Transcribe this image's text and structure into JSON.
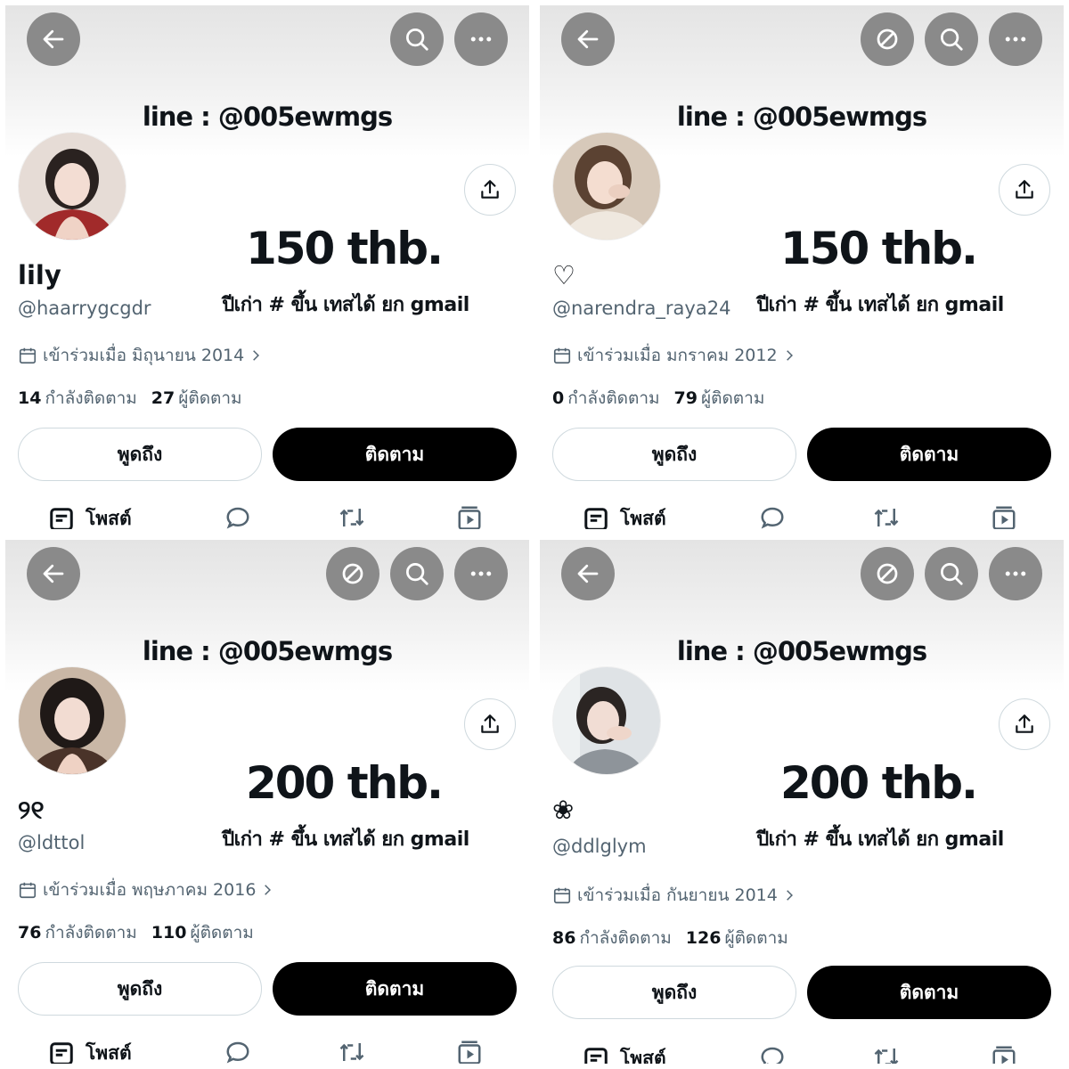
{
  "banner_text": "line : @005ewmgs",
  "shared": {
    "description": "ปีเก่า # ขึ้น เทสได้ ยก gmail",
    "joined_prefix": "เข้าร่วมเมื่อ",
    "following_label": "กำลังติดตาม",
    "followers_label": "ผู้ติดตาม",
    "mention_label": "พูดถึง",
    "follow_label": "ติดตาม",
    "posts_tab_label": "โพสต์"
  },
  "colors": {
    "control_bg": "#8a8a8a",
    "follow_bg": "#000000",
    "muted_text": "#536471",
    "text": "#0f1419"
  },
  "icons": [
    "back-arrow-icon",
    "block-icon",
    "search-icon",
    "more-icon",
    "share-icon",
    "calendar-icon",
    "chevron-right-icon",
    "posts-icon",
    "replies-icon",
    "reposts-icon",
    "media-icon"
  ],
  "profiles": [
    {
      "display_name": "lily",
      "handle": "@haarrygcgdr",
      "price": "150 thb.",
      "joined_date": "มิถุนายน 2014",
      "following": "14",
      "followers": "27"
    },
    {
      "display_name": "♡",
      "handle": "@narendra_raya24",
      "price": "150 thb.",
      "joined_date": "มกราคม 2012",
      "following": "0",
      "followers": "79"
    },
    {
      "display_name": "୨୧",
      "handle": "@ldttol",
      "price": "200 thb.",
      "joined_date": "พฤษภาคม 2016",
      "following": "76",
      "followers": "110"
    },
    {
      "display_name": "❀",
      "handle": "@ddlglym",
      "price": "200 thb.",
      "joined_date": "กันยายน 2014",
      "following": "86",
      "followers": "126"
    }
  ]
}
